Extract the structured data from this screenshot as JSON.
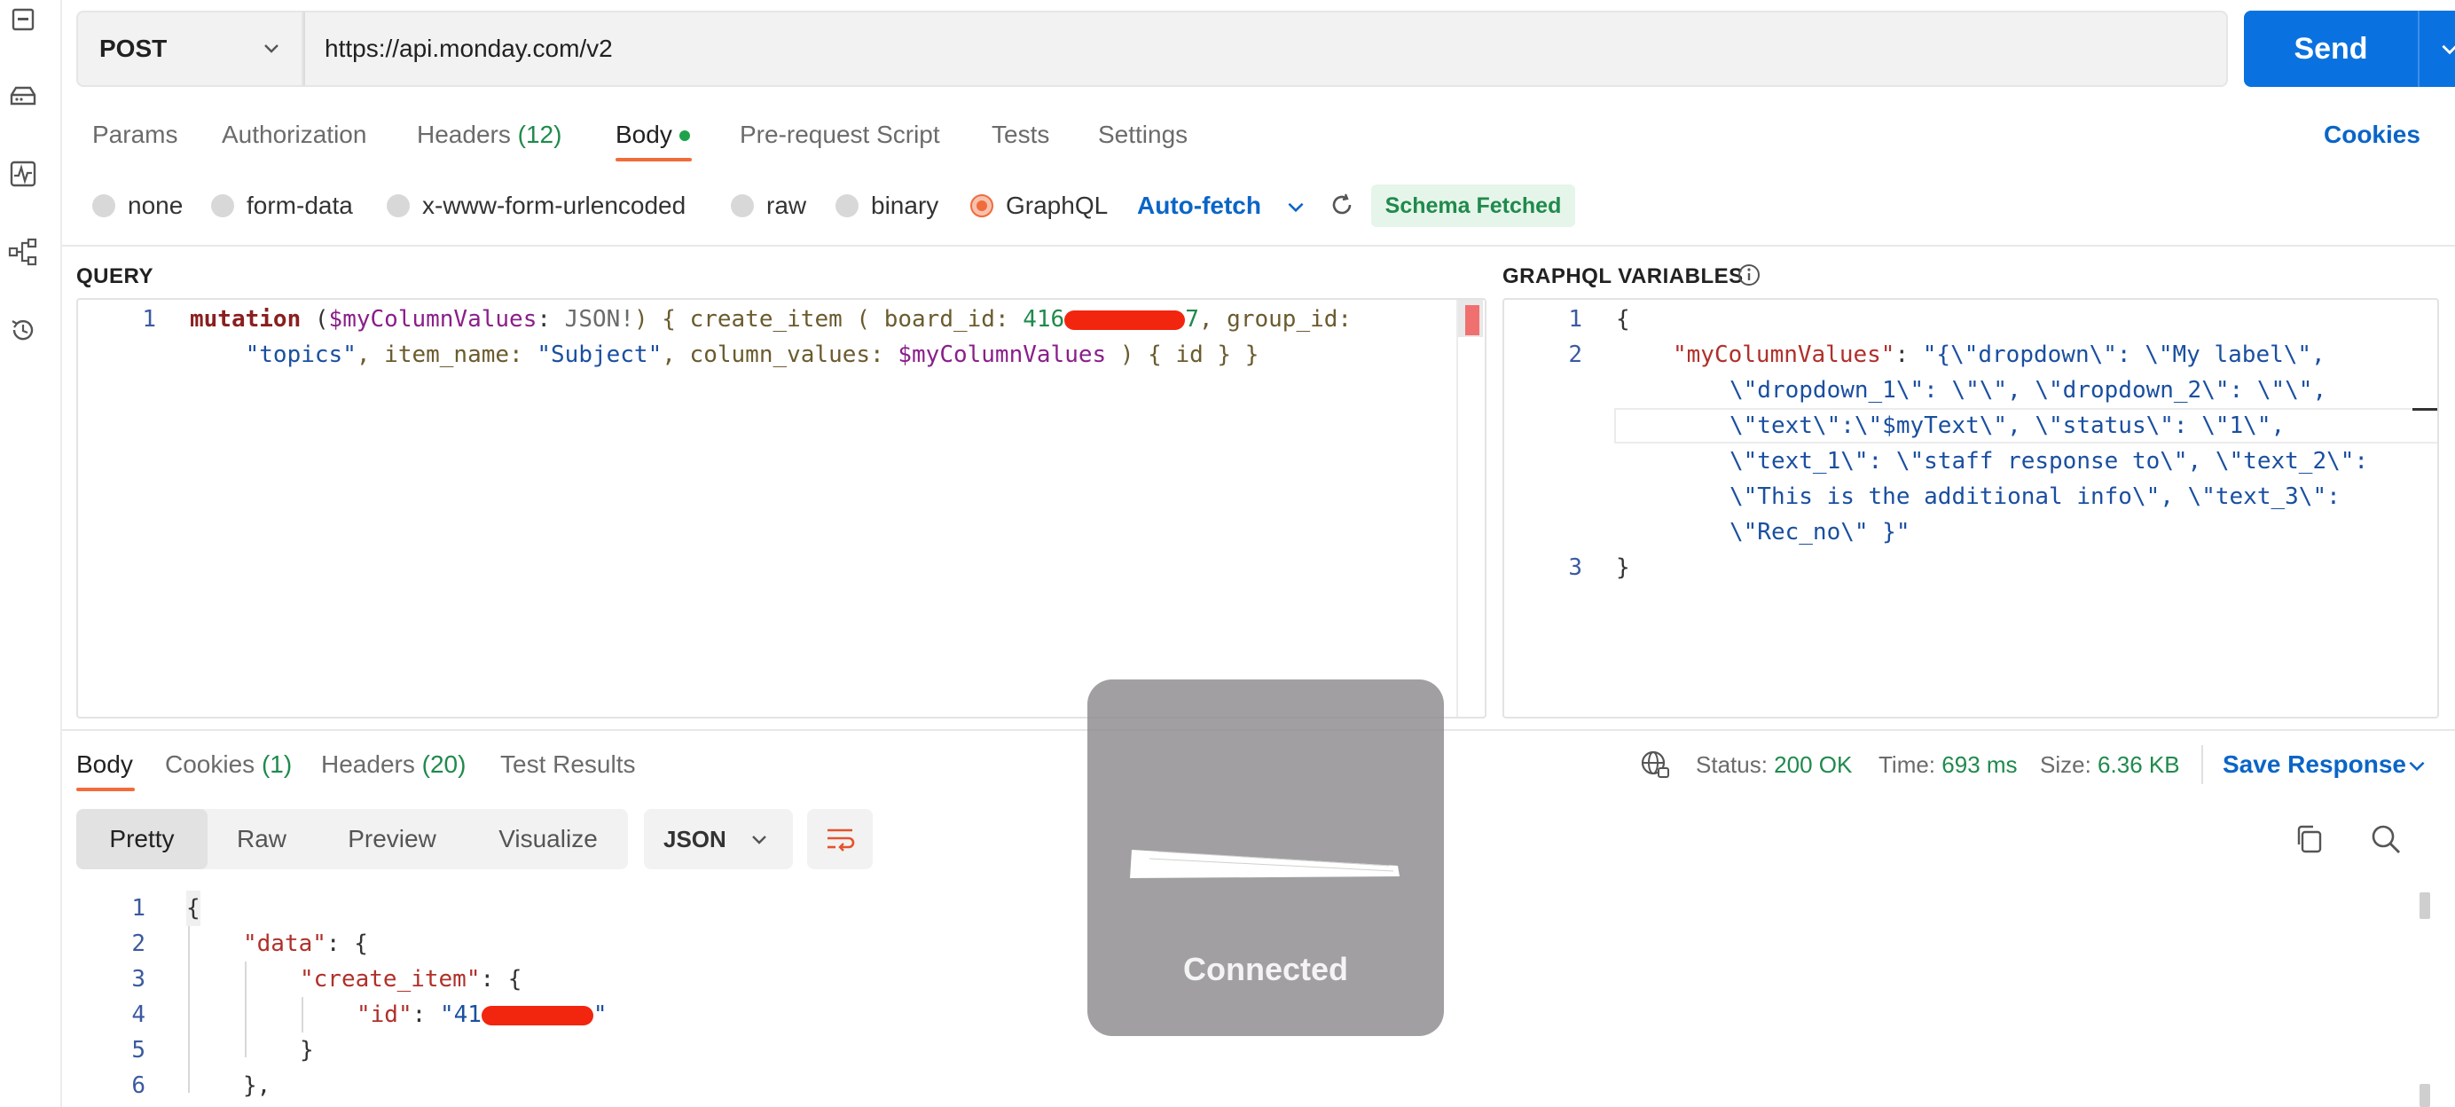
{
  "request": {
    "method": "POST",
    "url": "https://api.monday.com/v2",
    "send_label": "Send"
  },
  "request_tabs": {
    "params": "Params",
    "authorization": "Authorization",
    "headers": "Headers",
    "headers_count": "(12)",
    "body": "Body",
    "prerequest": "Pre-request Script",
    "tests": "Tests",
    "settings": "Settings",
    "cookies": "Cookies"
  },
  "body_modes": {
    "none": "none",
    "form_data": "form-data",
    "urlencoded": "x-www-form-urlencoded",
    "raw": "raw",
    "binary": "binary",
    "graphql": "GraphQL",
    "selected": "GraphQL",
    "autofetch": "Auto-fetch",
    "schema_status": "Schema Fetched"
  },
  "query": {
    "label": "QUERY",
    "line_numbers": [
      "1"
    ],
    "tokens": {
      "kw": "mutation",
      "p1": " (",
      "var1": "$myColumnValues",
      "p2": ": ",
      "type": "JSON!",
      "p3": ") { create_item ( board_id: ",
      "board_prefix": "416",
      "board_suffix": "7",
      "p4": ", group_id:",
      "indent": "    ",
      "group": "\"topics\"",
      "p5": ", item_name: ",
      "item": "\"Subject\"",
      "p6": ", column_values: ",
      "var2": "$myColumnValues",
      "p7": " ) { id } }"
    }
  },
  "variables": {
    "label": "GRAPHQL VARIABLES",
    "line_numbers": [
      "1",
      "2",
      "3"
    ],
    "lines": {
      "open": "{",
      "key": "\"myColumnValues\"",
      "colon": ": ",
      "v1": "\"{\\\"dropdown\\\": \\\"My label\\\",",
      "v2": "\\\"dropdown_1\\\": \\\"\\\", \\\"dropdown_2\\\": \\\"\\\",",
      "v3": "\\\"text\\\":\\\"$myText\\\", \\\"status\\\": \\\"1\\\",",
      "v4": "\\\"text_1\\\": \\\"staff response to\\\", \\\"text_2\\\":",
      "v5": "\\\"This is the additional info\\\", \\\"text_3\\\":",
      "v6": "\\\"Rec_no\\\" }\"",
      "close": "}"
    }
  },
  "response_tabs": {
    "body": "Body",
    "cookies": "Cookies",
    "cookies_count": "(1)",
    "headers": "Headers",
    "headers_count": "(20)",
    "test_results": "Test Results"
  },
  "response_meta": {
    "status_label": "Status:",
    "status_value": "200 OK",
    "time_label": "Time:",
    "time_value": "693 ms",
    "size_label": "Size:",
    "size_value": "6.36 KB",
    "save": "Save Response"
  },
  "response_view": {
    "pretty": "Pretty",
    "raw": "Raw",
    "preview": "Preview",
    "visualize": "Visualize",
    "format": "JSON"
  },
  "response_body": {
    "line_numbers": [
      "1",
      "2",
      "3",
      "4",
      "5",
      "6"
    ],
    "open": "{",
    "data_key": "\"data\"",
    "create_key": "\"create_item\"",
    "id_key": "\"id\"",
    "id_prefix": "\"41",
    "id_suffix": "\"",
    "colon_brace": ": {",
    "colon": ": ",
    "close_inner": "}",
    "close_data": "},"
  },
  "overlay": {
    "label": "Connected"
  }
}
